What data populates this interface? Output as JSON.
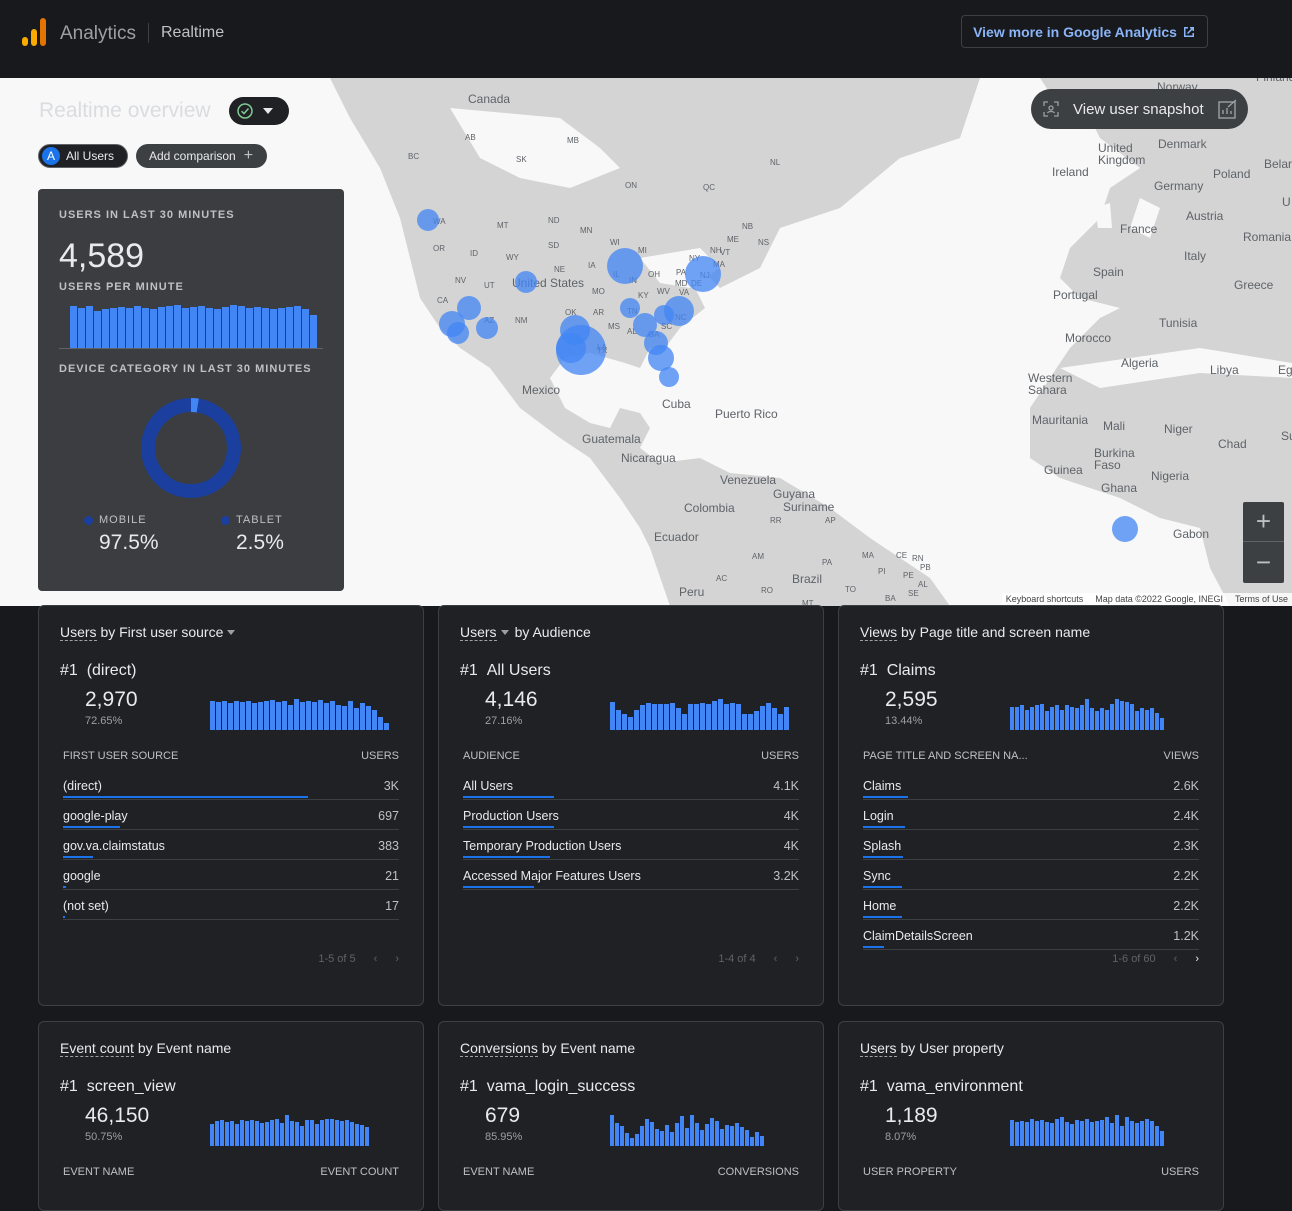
{
  "header": {
    "app_name": "Analytics",
    "page_name": "Realtime",
    "ga_button": "View more in Google Analytics"
  },
  "overview": {
    "title": "Realtime overview",
    "all_users_chip": "All Users",
    "all_users_letter": "A",
    "add_comparison": "Add comparison",
    "snapshot_button": "View user snapshot"
  },
  "realtime": {
    "users_label": "USERS IN LAST 30 MINUTES",
    "users_value": "4,589",
    "per_minute_label": "USERS PER MINUTE",
    "per_minute_bars": [
      38,
      36,
      38,
      34,
      35,
      36,
      37,
      36,
      38,
      36,
      35,
      37,
      38,
      39,
      36,
      37,
      38,
      36,
      35,
      37,
      39,
      38,
      36,
      37,
      36,
      35,
      36,
      37,
      38,
      35,
      30
    ],
    "device_label": "DEVICE CATEGORY IN LAST 30 MINUTES",
    "mobile_label": "MOBILE",
    "mobile_value": "97.5%",
    "mobile_fraction": 0.975,
    "tablet_label": "TABLET",
    "tablet_value": "2.5%",
    "tablet_fraction": 0.025,
    "mobile_color": "#1a3f9e",
    "tablet_color": "#4285f4"
  },
  "map": {
    "attribution": {
      "shortcuts": "Keyboard shortcuts",
      "data": "Map data ©2022 Google, INEGI",
      "terms": "Terms of Use"
    },
    "labels": {
      "canada": "Canada",
      "united_states": "United States",
      "mexico": "Mexico",
      "cuba": "Cuba",
      "puerto_rico": "Puerto Rico",
      "guatemala": "Guatemala",
      "nicaragua": "Nicaragua",
      "venezuela": "Venezuela",
      "colombia": "Colombia",
      "guyana": "Guyana",
      "suriname": "Suriname",
      "ecuador": "Ecuador",
      "peru": "Peru",
      "brazil": "Brazil",
      "norway": "Norway",
      "finland": "Finland",
      "denmark": "Denmark",
      "united_kingdom": "United Kingdom",
      "ireland": "Ireland",
      "poland": "Poland",
      "belarus": "Belar",
      "germany": "Germany",
      "austria": "Austria",
      "france": "France",
      "romania": "Romania",
      "italy": "Italy",
      "spain": "Spain",
      "portugal": "Portugal",
      "greece": "Greece",
      "tunisia": "Tunisia",
      "morocco": "Morocco",
      "algeria": "Algeria",
      "libya": "Libya",
      "egypt": "Eg",
      "western_sahara": "Western Sahara",
      "mauritania": "Mauritania",
      "mali": "Mali",
      "niger": "Niger",
      "chad": "Chad",
      "sudan": "Su",
      "burkina_faso": "Burkina Faso",
      "guinea": "Guinea",
      "ghana": "Ghana",
      "nigeria": "Nigeria",
      "gabon": "Gabon",
      "ukraine": "U"
    },
    "states": [
      "WA",
      "OR",
      "CA",
      "NV",
      "ID",
      "MT",
      "WY",
      "UT",
      "AZ",
      "NM",
      "ND",
      "SD",
      "NE",
      "MN",
      "IA",
      "WI",
      "IL",
      "MI",
      "IN",
      "OH",
      "KY",
      "TN",
      "MS",
      "AL",
      "GA",
      "SC",
      "NC",
      "VA",
      "WV",
      "MD",
      "DE",
      "PA",
      "NY",
      "NJ",
      "MA",
      "NH",
      "VT",
      "ME",
      "TX",
      "OK",
      "AR",
      "LA",
      "MO",
      "AB",
      "BC",
      "SK",
      "MB",
      "ON",
      "QC",
      "NB",
      "NS",
      "NL",
      "AC",
      "RO",
      "MT",
      "TO",
      "BA",
      "SE",
      "AL",
      "PE",
      "RN",
      "CE",
      "PI",
      "PB",
      "MA",
      "PA",
      "AM",
      "RR",
      "AP"
    ]
  },
  "cards": [
    {
      "title_a": "Users",
      "title_b": "by First user source",
      "dropdown": "second",
      "top_rank": "#1",
      "top_name": "(direct)",
      "top_value": "2,970",
      "top_pct": "72.65%",
      "spark": [
        26,
        25,
        26,
        24,
        26,
        25,
        26,
        24,
        25,
        26,
        27,
        25,
        26,
        23,
        28,
        25,
        26,
        25,
        27,
        24,
        26,
        23,
        22,
        26,
        20,
        24,
        22,
        18,
        12,
        6
      ],
      "col_a": "FIRST USER SOURCE",
      "col_b": "USERS",
      "rows": [
        {
          "name": "(direct)",
          "value": "3K",
          "pct": 0.73
        },
        {
          "name": "google-play",
          "value": "697",
          "pct": 0.17
        },
        {
          "name": "gov.va.claimstatus",
          "value": "383",
          "pct": 0.09
        },
        {
          "name": "google",
          "value": "21",
          "pct": 0.01
        },
        {
          "name": "(not set)",
          "value": "17",
          "pct": 0.005
        }
      ],
      "pager": "1-5 of 5"
    },
    {
      "title_a": "Users",
      "title_b": "by Audience",
      "dropdown": "first",
      "top_rank": "#1",
      "top_name": "All Users",
      "top_value": "4,146",
      "top_pct": "27.16%",
      "spark": [
        31,
        22,
        18,
        14,
        22,
        27,
        30,
        29,
        28,
        29,
        30,
        24,
        17,
        28,
        29,
        30,
        28,
        32,
        34,
        28,
        30,
        29,
        17,
        18,
        21,
        26,
        30,
        24,
        18,
        25
      ],
      "col_a": "AUDIENCE",
      "col_b": "USERS",
      "rows": [
        {
          "name": "All Users",
          "value": "4.1K",
          "pct": 0.27
        },
        {
          "name": "Production Users",
          "value": "4K",
          "pct": 0.27
        },
        {
          "name": "Temporary Production Users",
          "value": "4K",
          "pct": 0.26
        },
        {
          "name": "Accessed Major Features Users",
          "value": "3.2K",
          "pct": 0.21
        }
      ],
      "pager": "1-4 of 4"
    },
    {
      "title_a": "Views",
      "title_b": "by Page title and screen name",
      "dropdown": "none",
      "top_rank": "#1",
      "top_name": "Claims",
      "top_value": "2,595",
      "top_pct": "13.44%",
      "spark": [
        15,
        15,
        16,
        13,
        15,
        16,
        17,
        12,
        15,
        16,
        13,
        16,
        15,
        14,
        16,
        20,
        14,
        12,
        14,
        13,
        17,
        20,
        19,
        18,
        17,
        12,
        14,
        13,
        14,
        11,
        8
      ],
      "col_a": "PAGE TITLE AND SCREEN NA...",
      "col_b": "VIEWS",
      "rows": [
        {
          "name": "Claims",
          "value": "2.6K",
          "pct": 0.135
        },
        {
          "name": "Login",
          "value": "2.4K",
          "pct": 0.125
        },
        {
          "name": "Splash",
          "value": "2.3K",
          "pct": 0.12
        },
        {
          "name": "Sync",
          "value": "2.2K",
          "pct": 0.115
        },
        {
          "name": "Home",
          "value": "2.2K",
          "pct": 0.115
        },
        {
          "name": "ClaimDetailsScreen",
          "value": "1.2K",
          "pct": 0.063
        }
      ],
      "pager": "1-6 of 60"
    },
    {
      "title_a": "Event count",
      "title_b": "by Event name",
      "dropdown": "none",
      "top_rank": "#1",
      "top_name": "screen_view",
      "top_value": "46,150",
      "top_pct": "50.75%",
      "spark": [
        24,
        27,
        28,
        26,
        27,
        24,
        28,
        27,
        29,
        27,
        25,
        26,
        28,
        30,
        25,
        34,
        27,
        26,
        22,
        28,
        29,
        24,
        28,
        30,
        30,
        29,
        27,
        28,
        26,
        24,
        23,
        21
      ],
      "col_a": "EVENT NAME",
      "col_b": "EVENT COUNT",
      "rows": [],
      "pager": ""
    },
    {
      "title_a": "Conversions",
      "title_b": "by Event name",
      "dropdown": "none",
      "top_rank": "#1",
      "top_name": "vama_login_success",
      "top_value": "679",
      "top_pct": "85.95%",
      "spark": [
        31,
        23,
        20,
        13,
        8,
        12,
        20,
        27,
        24,
        17,
        15,
        21,
        14,
        23,
        30,
        18,
        31,
        23,
        16,
        22,
        28,
        25,
        17,
        21,
        20,
        23,
        19,
        16,
        9,
        14,
        10
      ],
      "col_a": "EVENT NAME",
      "col_b": "CONVERSIONS",
      "rows": [],
      "pager": ""
    },
    {
      "title_a": "Users",
      "title_b": "by User property",
      "dropdown": "none",
      "top_rank": "#1",
      "top_name": "vama_environment",
      "top_value": "1,189",
      "top_pct": "8.07%",
      "spark": [
        29,
        27,
        28,
        27,
        30,
        28,
        29,
        27,
        26,
        31,
        33,
        27,
        25,
        29,
        28,
        30,
        27,
        28,
        29,
        33,
        26,
        35,
        23,
        33,
        28,
        26,
        28,
        30,
        28,
        23,
        17
      ],
      "col_a": "USER PROPERTY",
      "col_b": "USERS",
      "rows": [],
      "pager": ""
    }
  ]
}
